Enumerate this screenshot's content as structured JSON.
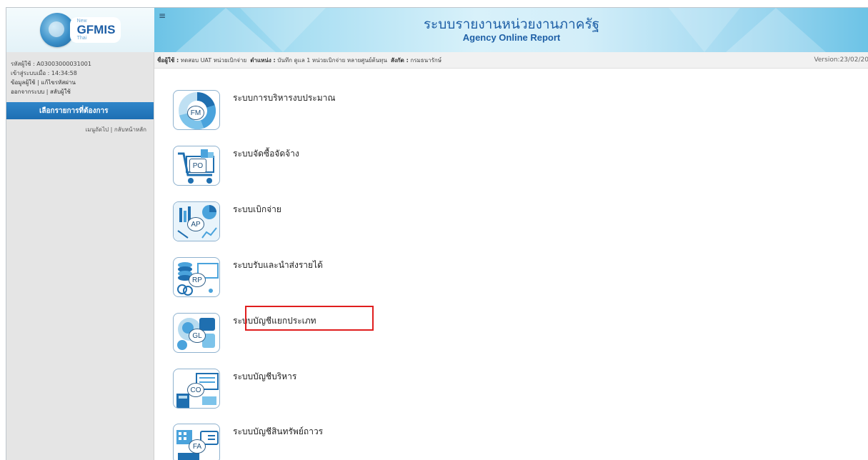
{
  "header": {
    "logo_new": "New",
    "logo_text": "GFMIS",
    "logo_thai": "Thai",
    "menu_toggle_icon": "≡",
    "title": "ระบบรายงานหน่วยงานภาครัฐ",
    "subtitle": "Agency Online Report"
  },
  "sidebar": {
    "user_id": "รหัสผู้ใช้ : A03003000031001",
    "login_time": "เข้าสู่ระบบเมื่อ : 14:34:58",
    "user_info_link": "ข้อมูลผู้ใช้",
    "change_password_link": "แก้ไขรหัสผ่าน",
    "logout_link": "ออกจากระบบ",
    "switch_user_link": "สลับผู้ใช้",
    "section_title": "เลือกรายการที่ต้องการ",
    "next_menu_link": "เมนูถัดไป",
    "home_link": "กลับหน้าหลัก",
    "separator": "|"
  },
  "infobar": {
    "user_label": "ชื่อผู้ใช้ :",
    "user_value": "ทดสอบ UAT หน่วยเบิกจ่าย",
    "position_label": "ตำแหน่ง :",
    "position_value": "บันทึก ดูแล 1 หน่วยเบิกจ่าย หลายศูนย์ต้นทุน",
    "agency_label": "สังกัด :",
    "agency_value": "กรมธนารักษ์",
    "version": "Version:23/02/20"
  },
  "systems": [
    {
      "code": "FM",
      "label": "ระบบการบริหารงบประมาณ",
      "icon": "fm-donut-chart-icon"
    },
    {
      "code": "PO",
      "label": "ระบบจัดซื้อจัดจ้าง",
      "icon": "po-shopping-cart-icon"
    },
    {
      "code": "AP",
      "label": "ระบบเบิกจ่าย",
      "icon": "ap-chart-icon"
    },
    {
      "code": "RP",
      "label": "ระบบรับและนำส่งรายได้",
      "icon": "rp-coins-icon"
    },
    {
      "code": "GL",
      "label": "ระบบบัญชีแยกประเภท",
      "icon": "gl-globe-icon"
    },
    {
      "code": "CO",
      "label": "ระบบบัญชีบริหาร",
      "icon": "co-calculator-icon"
    },
    {
      "code": "FA",
      "label": "ระบบบัญชีสินทรัพย์ถาวร",
      "icon": "fa-building-icon"
    }
  ],
  "colors": {
    "highlight": "#e01e1e",
    "section_header": "#1d6fb3",
    "brand_blue": "#1e5fa6"
  }
}
